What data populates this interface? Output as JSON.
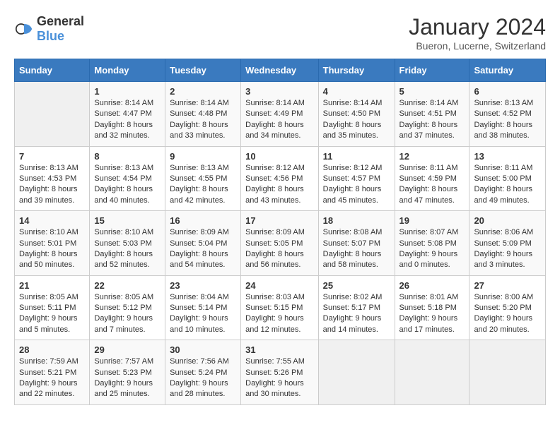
{
  "header": {
    "logo_general": "General",
    "logo_blue": "Blue",
    "month_year": "January 2024",
    "location": "Bueron, Lucerne, Switzerland"
  },
  "days_of_week": [
    "Sunday",
    "Monday",
    "Tuesday",
    "Wednesday",
    "Thursday",
    "Friday",
    "Saturday"
  ],
  "weeks": [
    [
      {
        "day": "",
        "sunrise": "",
        "sunset": "",
        "daylight": ""
      },
      {
        "day": "1",
        "sunrise": "Sunrise: 8:14 AM",
        "sunset": "Sunset: 4:47 PM",
        "daylight": "Daylight: 8 hours and 32 minutes."
      },
      {
        "day": "2",
        "sunrise": "Sunrise: 8:14 AM",
        "sunset": "Sunset: 4:48 PM",
        "daylight": "Daylight: 8 hours and 33 minutes."
      },
      {
        "day": "3",
        "sunrise": "Sunrise: 8:14 AM",
        "sunset": "Sunset: 4:49 PM",
        "daylight": "Daylight: 8 hours and 34 minutes."
      },
      {
        "day": "4",
        "sunrise": "Sunrise: 8:14 AM",
        "sunset": "Sunset: 4:50 PM",
        "daylight": "Daylight: 8 hours and 35 minutes."
      },
      {
        "day": "5",
        "sunrise": "Sunrise: 8:14 AM",
        "sunset": "Sunset: 4:51 PM",
        "daylight": "Daylight: 8 hours and 37 minutes."
      },
      {
        "day": "6",
        "sunrise": "Sunrise: 8:13 AM",
        "sunset": "Sunset: 4:52 PM",
        "daylight": "Daylight: 8 hours and 38 minutes."
      }
    ],
    [
      {
        "day": "7",
        "sunrise": "Sunrise: 8:13 AM",
        "sunset": "Sunset: 4:53 PM",
        "daylight": "Daylight: 8 hours and 39 minutes."
      },
      {
        "day": "8",
        "sunrise": "Sunrise: 8:13 AM",
        "sunset": "Sunset: 4:54 PM",
        "daylight": "Daylight: 8 hours and 40 minutes."
      },
      {
        "day": "9",
        "sunrise": "Sunrise: 8:13 AM",
        "sunset": "Sunset: 4:55 PM",
        "daylight": "Daylight: 8 hours and 42 minutes."
      },
      {
        "day": "10",
        "sunrise": "Sunrise: 8:12 AM",
        "sunset": "Sunset: 4:56 PM",
        "daylight": "Daylight: 8 hours and 43 minutes."
      },
      {
        "day": "11",
        "sunrise": "Sunrise: 8:12 AM",
        "sunset": "Sunset: 4:57 PM",
        "daylight": "Daylight: 8 hours and 45 minutes."
      },
      {
        "day": "12",
        "sunrise": "Sunrise: 8:11 AM",
        "sunset": "Sunset: 4:59 PM",
        "daylight": "Daylight: 8 hours and 47 minutes."
      },
      {
        "day": "13",
        "sunrise": "Sunrise: 8:11 AM",
        "sunset": "Sunset: 5:00 PM",
        "daylight": "Daylight: 8 hours and 49 minutes."
      }
    ],
    [
      {
        "day": "14",
        "sunrise": "Sunrise: 8:10 AM",
        "sunset": "Sunset: 5:01 PM",
        "daylight": "Daylight: 8 hours and 50 minutes."
      },
      {
        "day": "15",
        "sunrise": "Sunrise: 8:10 AM",
        "sunset": "Sunset: 5:03 PM",
        "daylight": "Daylight: 8 hours and 52 minutes."
      },
      {
        "day": "16",
        "sunrise": "Sunrise: 8:09 AM",
        "sunset": "Sunset: 5:04 PM",
        "daylight": "Daylight: 8 hours and 54 minutes."
      },
      {
        "day": "17",
        "sunrise": "Sunrise: 8:09 AM",
        "sunset": "Sunset: 5:05 PM",
        "daylight": "Daylight: 8 hours and 56 minutes."
      },
      {
        "day": "18",
        "sunrise": "Sunrise: 8:08 AM",
        "sunset": "Sunset: 5:07 PM",
        "daylight": "Daylight: 8 hours and 58 minutes."
      },
      {
        "day": "19",
        "sunrise": "Sunrise: 8:07 AM",
        "sunset": "Sunset: 5:08 PM",
        "daylight": "Daylight: 9 hours and 0 minutes."
      },
      {
        "day": "20",
        "sunrise": "Sunrise: 8:06 AM",
        "sunset": "Sunset: 5:09 PM",
        "daylight": "Daylight: 9 hours and 3 minutes."
      }
    ],
    [
      {
        "day": "21",
        "sunrise": "Sunrise: 8:05 AM",
        "sunset": "Sunset: 5:11 PM",
        "daylight": "Daylight: 9 hours and 5 minutes."
      },
      {
        "day": "22",
        "sunrise": "Sunrise: 8:05 AM",
        "sunset": "Sunset: 5:12 PM",
        "daylight": "Daylight: 9 hours and 7 minutes."
      },
      {
        "day": "23",
        "sunrise": "Sunrise: 8:04 AM",
        "sunset": "Sunset: 5:14 PM",
        "daylight": "Daylight: 9 hours and 10 minutes."
      },
      {
        "day": "24",
        "sunrise": "Sunrise: 8:03 AM",
        "sunset": "Sunset: 5:15 PM",
        "daylight": "Daylight: 9 hours and 12 minutes."
      },
      {
        "day": "25",
        "sunrise": "Sunrise: 8:02 AM",
        "sunset": "Sunset: 5:17 PM",
        "daylight": "Daylight: 9 hours and 14 minutes."
      },
      {
        "day": "26",
        "sunrise": "Sunrise: 8:01 AM",
        "sunset": "Sunset: 5:18 PM",
        "daylight": "Daylight: 9 hours and 17 minutes."
      },
      {
        "day": "27",
        "sunrise": "Sunrise: 8:00 AM",
        "sunset": "Sunset: 5:20 PM",
        "daylight": "Daylight: 9 hours and 20 minutes."
      }
    ],
    [
      {
        "day": "28",
        "sunrise": "Sunrise: 7:59 AM",
        "sunset": "Sunset: 5:21 PM",
        "daylight": "Daylight: 9 hours and 22 minutes."
      },
      {
        "day": "29",
        "sunrise": "Sunrise: 7:57 AM",
        "sunset": "Sunset: 5:23 PM",
        "daylight": "Daylight: 9 hours and 25 minutes."
      },
      {
        "day": "30",
        "sunrise": "Sunrise: 7:56 AM",
        "sunset": "Sunset: 5:24 PM",
        "daylight": "Daylight: 9 hours and 28 minutes."
      },
      {
        "day": "31",
        "sunrise": "Sunrise: 7:55 AM",
        "sunset": "Sunset: 5:26 PM",
        "daylight": "Daylight: 9 hours and 30 minutes."
      },
      {
        "day": "",
        "sunrise": "",
        "sunset": "",
        "daylight": ""
      },
      {
        "day": "",
        "sunrise": "",
        "sunset": "",
        "daylight": ""
      },
      {
        "day": "",
        "sunrise": "",
        "sunset": "",
        "daylight": ""
      }
    ]
  ]
}
